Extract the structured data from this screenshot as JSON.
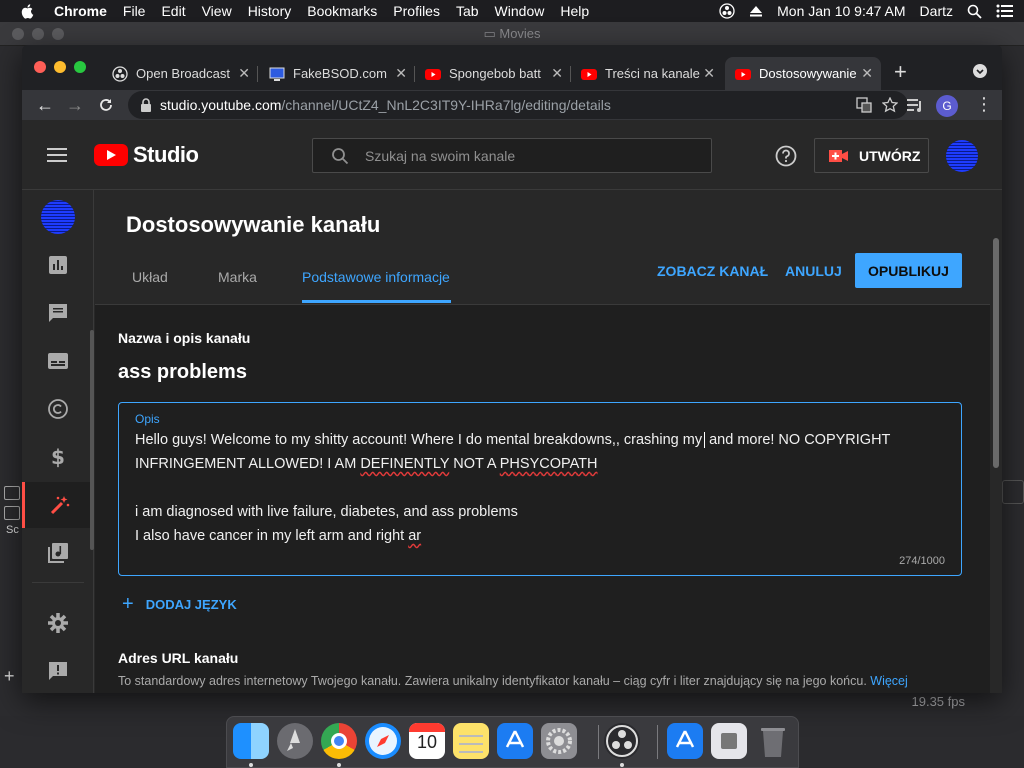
{
  "menubar": {
    "app_name": "Chrome",
    "items": [
      "File",
      "Edit",
      "View",
      "History",
      "Bookmarks",
      "Profiles",
      "Tab",
      "Window",
      "Help"
    ],
    "datetime": "Mon Jan 10  9:47 AM",
    "user": "Dartz"
  },
  "background_window": {
    "title": "Movies",
    "status_fps": "19.35 fps",
    "side_label": "Sc"
  },
  "browser": {
    "tabs": [
      {
        "label": "Open Broadcast",
        "icon": "obs-icon"
      },
      {
        "label": "FakeBSOD.com",
        "icon": "bsod-icon"
      },
      {
        "label": "Spongebob batt",
        "icon": "youtube-icon"
      },
      {
        "label": "Treści na kanale",
        "icon": "youtube-icon"
      },
      {
        "label": "Dostosowywanie",
        "icon": "youtube-icon"
      }
    ],
    "url_host": "studio.youtube.com",
    "url_path": "/channel/UCtZ4_NnL2C3IT9Y-IHRa7lg/editing/details",
    "profile_initial": "G"
  },
  "studio": {
    "logo_text": "Studio",
    "search_placeholder": "Szukaj na swoim kanale",
    "create_label": "UTWÓRZ",
    "page_title": "Dostosowywanie kanału",
    "tabs": [
      "Układ",
      "Marka",
      "Podstawowe informacje"
    ],
    "view_channel": "ZOBACZ KANAŁ",
    "cancel": "ANULUJ",
    "publish": "OPUBLIKUJ",
    "section_name_title": "Nazwa i opis kanału",
    "channel_name": "ass problems",
    "desc_label": "Opis",
    "desc_line1a": "Hello guys! Welcome to my shitty account! Where I do mental breakdowns,, crashing my",
    "desc_line1b": " and more! NO COPYRIGHT",
    "desc_line2a": "INFRINGEMENT ALLOWED! I AM ",
    "desc_line2b": "DEFINENTLY",
    "desc_line2c": " NOT A  ",
    "desc_line2d": "PHSYCOPATH",
    "desc_line3": "i am diagnosed with live failure, diabetes, and ass problems",
    "desc_line4a": "I also have cancer in my left arm and right ",
    "desc_line4b": "ar",
    "char_count": "274/1000",
    "add_language": "DODAJ JĘZYK",
    "url_section_title": "Adres URL kanału",
    "url_section_desc": "To standardowy adres internetowy Twojego kanału. Zawiera unikalny identyfikator kanału – ciąg cyfr i liter znajdujący się na jego końcu.",
    "url_section_more": "Więcej"
  },
  "colors": {
    "accent": "#3ea6ff",
    "youtube_red": "#ff0000",
    "background": "#1f1f1f"
  }
}
